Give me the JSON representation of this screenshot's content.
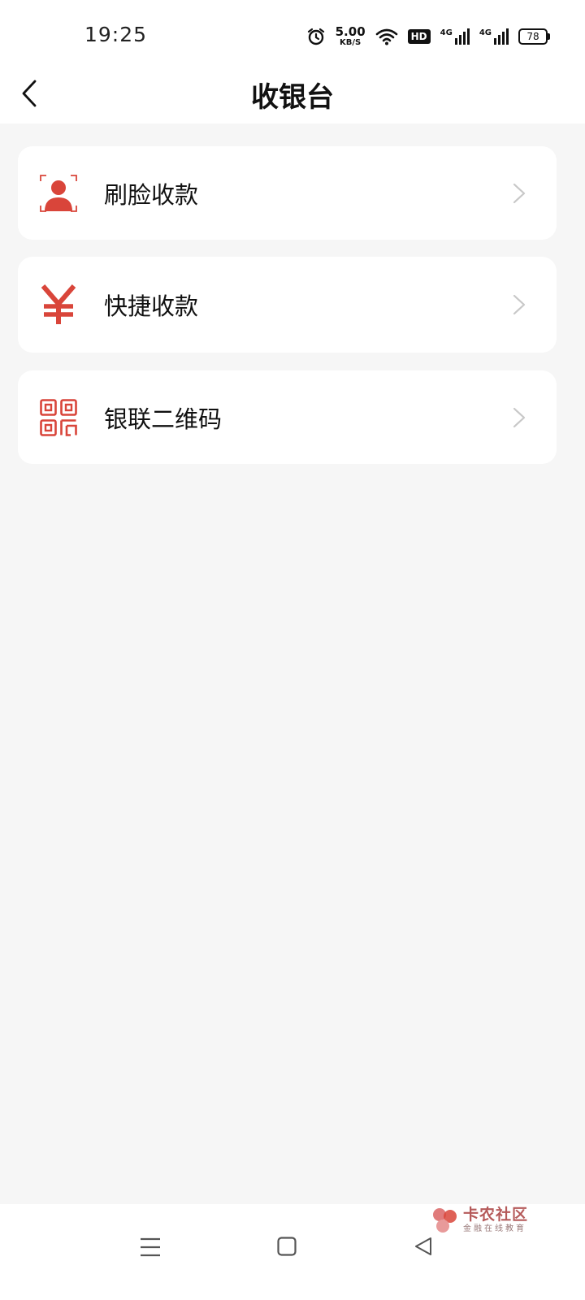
{
  "status_bar": {
    "time": "19:25",
    "speed_value": "5.00",
    "speed_unit": "KB/S",
    "hd_badge": "HD",
    "signal1_label": "4G",
    "signal2_label": "4G",
    "battery_level": "78",
    "icons": [
      "alarm-icon",
      "wifi-icon",
      "signal-icon",
      "battery-icon"
    ]
  },
  "header": {
    "title": "收银台",
    "back_icon": "chevron-left-icon"
  },
  "menu": {
    "items": [
      {
        "label": "刷脸收款",
        "icon": "face-pay-icon"
      },
      {
        "label": "快捷收款",
        "icon": "yuan-icon"
      },
      {
        "label": "银联二维码",
        "icon": "qr-code-icon"
      }
    ]
  },
  "watermark": {
    "main": "卡农社区",
    "sub": "金融在线教育"
  },
  "theme": {
    "accent": "#d9453a",
    "background": "#f6f6f6",
    "card": "#ffffff",
    "chevron": "#c8c8c8"
  }
}
